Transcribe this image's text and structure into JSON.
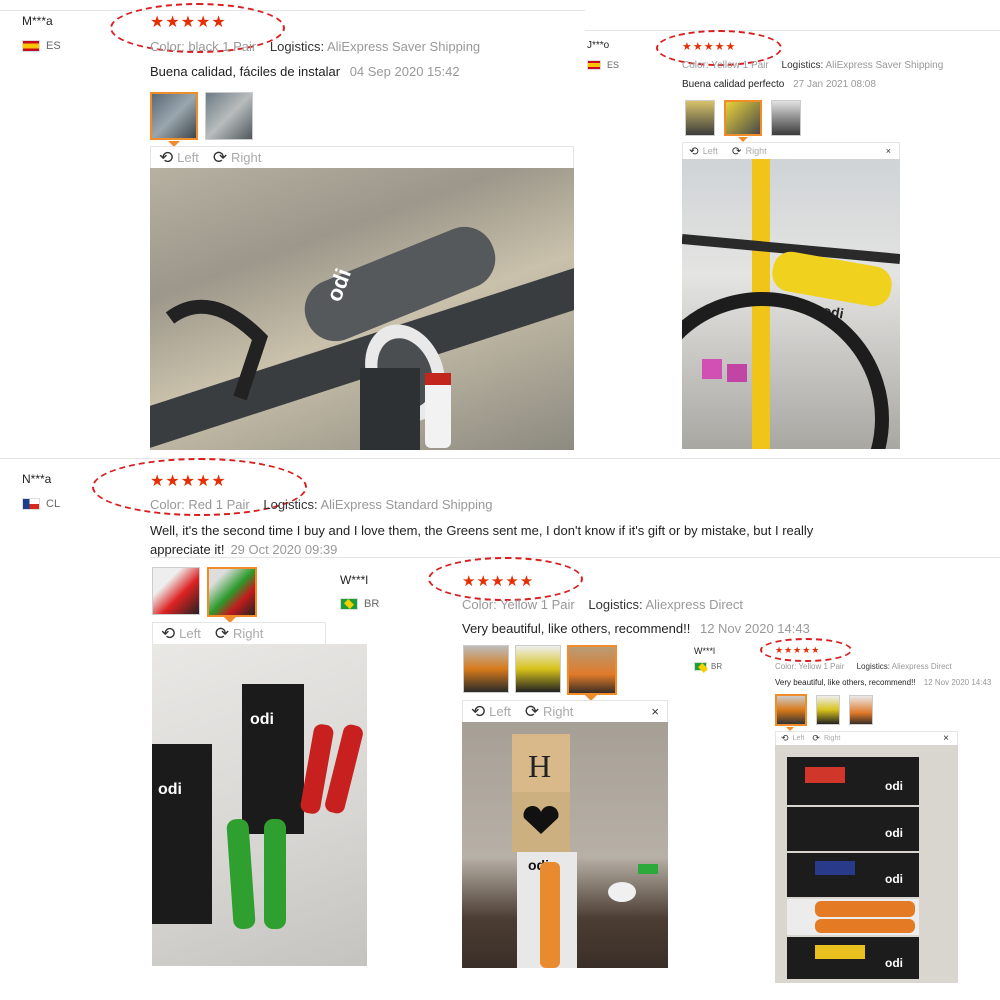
{
  "reviews": [
    {
      "user": "M***a",
      "country": "ES",
      "stars": "★★★★★",
      "color_label": "Color:",
      "color_value": "black 1 Pair",
      "logistics_label": "Logistics:",
      "logistics_value": "AliExpress Saver Shipping",
      "text": "Buena calidad, fáciles de instalar",
      "date": "04 Sep 2020 15:42",
      "viewer": {
        "left": "Left",
        "right": "Right"
      }
    },
    {
      "user": "J***o",
      "country": "ES",
      "stars": "★★★★★",
      "color_label": "Color:",
      "color_value": "Yellow 1 Pair",
      "logistics_label": "Logistics:",
      "logistics_value": "AliExpress Saver Shipping",
      "text": "Buena calidad perfecto",
      "date": "27 Jan 2021 08:08",
      "viewer": {
        "left": "Left",
        "right": "Right",
        "close": "×"
      }
    },
    {
      "user": "N***a",
      "country": "CL",
      "stars": "★★★★★",
      "color_label": "Color:",
      "color_value": "Red 1 Pair",
      "logistics_label": "Logistics:",
      "logistics_value": "AliExpress Standard Shipping",
      "text_line1": "Well, it's the second time I buy and I love them, the Greens sent me, I don't know if it's gift or by mistake, but I really",
      "text_line2": "appreciate it!",
      "date": "29 Oct 2020 09:39",
      "viewer": {
        "left": "Left",
        "right": "Right"
      }
    },
    {
      "user": "W***l",
      "country": "BR",
      "stars": "★★★★★",
      "color_label": "Color:",
      "color_value": "Yellow 1 Pair",
      "logistics_label": "Logistics:",
      "logistics_value": "Aliexpress Direct",
      "text": "Very beautiful, like others, recommend!!",
      "date": "12 Nov 2020 14:43",
      "viewer": {
        "left": "Left",
        "right": "Right",
        "close": "×"
      }
    },
    {
      "user": "W***l",
      "country": "BR",
      "stars": "★★★★★",
      "color_label": "Color:",
      "color_value": "Yellow 1 Pair",
      "logistics_label": "Logistics:",
      "logistics_value": "Aliexpress Direct",
      "text": "Very beautiful, like others, recommend!!",
      "date": "12 Nov 2020 14:43",
      "viewer": {
        "left": "Left",
        "right": "Right",
        "close": "×"
      }
    }
  ],
  "photos": {
    "letter_block": "H",
    "brand": "odi"
  },
  "colors": {
    "accent": "#e62e04",
    "highlight_ring": "#d81e1e",
    "selected_thumb": "#f08c2a"
  }
}
